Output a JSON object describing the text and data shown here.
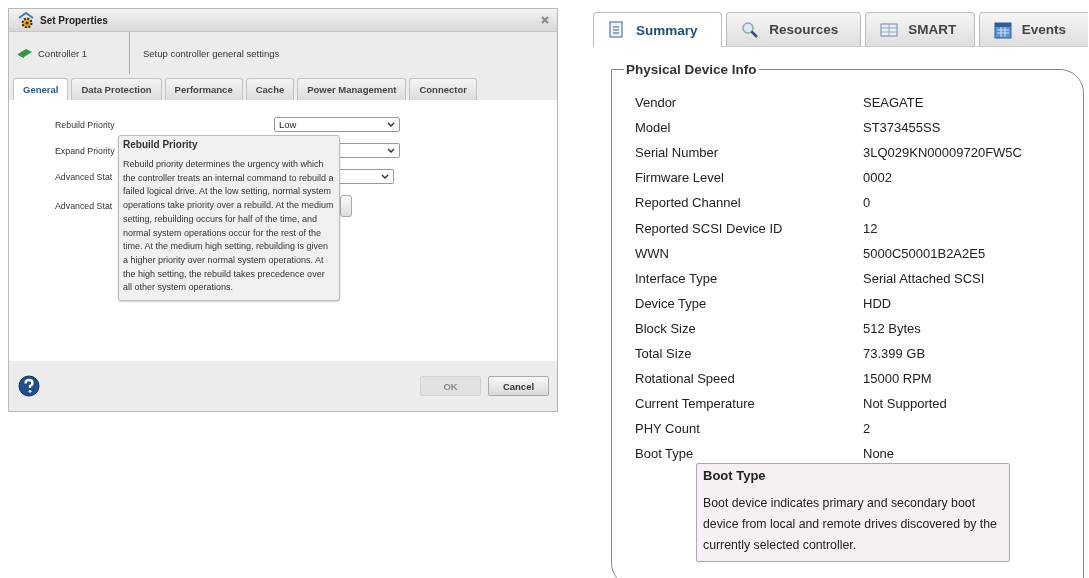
{
  "dialog": {
    "title": "Set Properties",
    "controller": "Controller 1",
    "description": "Setup controller general settings",
    "tabs": [
      {
        "label": "General",
        "selected": true
      },
      {
        "label": "Data Protection",
        "selected": false
      },
      {
        "label": "Performance",
        "selected": false
      },
      {
        "label": "Cache",
        "selected": false
      },
      {
        "label": "Power Management",
        "selected": false
      },
      {
        "label": "Connector",
        "selected": false
      }
    ],
    "fields": [
      {
        "label": "Rebuild Priority",
        "kind": "select",
        "value": "Low"
      },
      {
        "label": "Expand Priority",
        "kind": "select"
      },
      {
        "label": "Advanced Stat",
        "kind": "select"
      },
      {
        "label": "Advanced Stat",
        "kind": "button"
      }
    ],
    "tooltip": {
      "title": "Rebuild Priority",
      "text": "Rebuild priority determines the urgency with which the controller treats an internal command to rebuild a failed logical drive. At the low setting, normal system operations take priority over a rebuild. At the medium setting, rebuilding occurs for half of the time, and normal system operations occur for the rest of the time. At the medium high setting, rebuilding is given a higher priority over normal system operations. At the high setting, the rebuild takes precedence over all other system operations."
    },
    "buttons": [
      {
        "label": "OK",
        "disabled": true
      },
      {
        "label": "Cancel",
        "disabled": false
      }
    ]
  },
  "device": {
    "tabs": [
      {
        "label": "Summary",
        "kind": "document",
        "selected": true
      },
      {
        "label": "Resources",
        "kind": "search",
        "selected": false
      },
      {
        "label": "SMART",
        "kind": "table",
        "selected": false
      },
      {
        "label": "Events",
        "kind": "calendar",
        "selected": false
      }
    ],
    "group_title": "Physical Device Info",
    "rows": [
      {
        "label": "Vendor",
        "value": "SEAGATE"
      },
      {
        "label": "Model",
        "value": "ST373455SS"
      },
      {
        "label": "Serial Number",
        "value": "3LQ029KN00009720FW5C"
      },
      {
        "label": "Firmware Level",
        "value": "0002"
      },
      {
        "label": "Reported Channel",
        "value": "0"
      },
      {
        "label": "Reported SCSI Device ID",
        "value": "12"
      },
      {
        "label": "WWN",
        "value": "5000C50001B2A2E5"
      },
      {
        "label": "Interface Type",
        "value": "Serial Attached SCSI"
      },
      {
        "label": "Device Type",
        "value": "HDD"
      },
      {
        "label": "Block Size",
        "value": "512 Bytes"
      },
      {
        "label": "Total Size",
        "value": "73.399 GB"
      },
      {
        "label": "Rotational Speed",
        "value": "15000 RPM"
      },
      {
        "label": "Current Temperature",
        "value": "Not Supported"
      },
      {
        "label": "PHY Count",
        "value": "2"
      },
      {
        "label": "Boot Type",
        "value": "None"
      }
    ],
    "tooltip": {
      "title": "Boot Type",
      "text": "Boot device indicates primary and secondary boot device from local and remote drives discovered by the currently selected controller."
    }
  }
}
